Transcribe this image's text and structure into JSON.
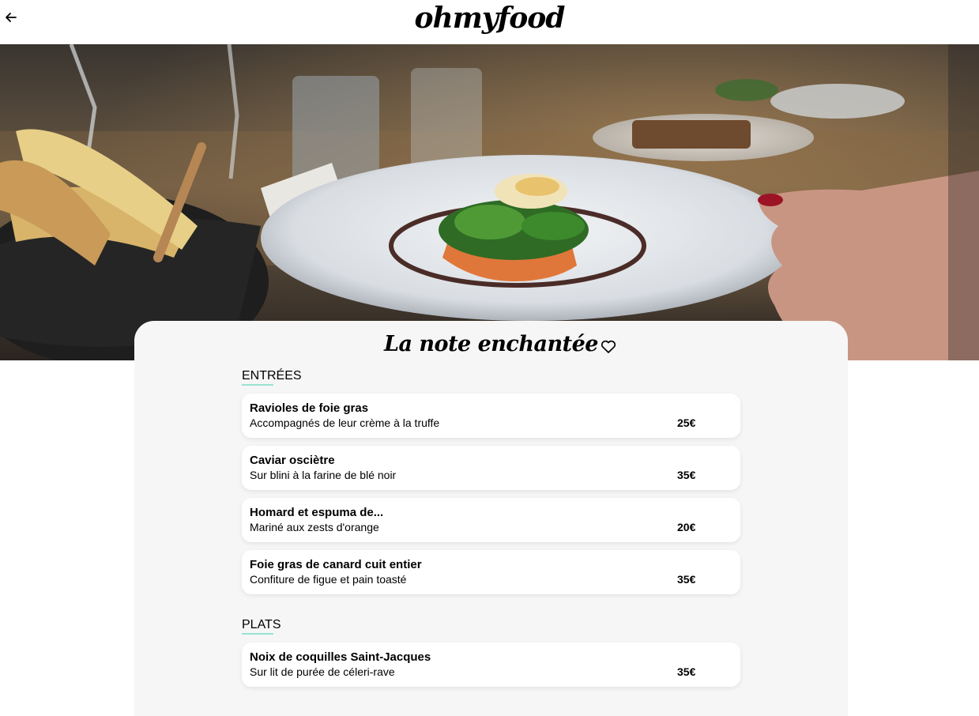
{
  "header": {
    "brand": "ohmyfood"
  },
  "restaurant": {
    "name": "La note enchantée"
  },
  "sections": [
    {
      "label": "ENTRÉES",
      "items": [
        {
          "name": "Ravioles de foie gras",
          "description": "Accompagnés de leur crème à la truffe",
          "price": "25€"
        },
        {
          "name": "Caviar osciètre",
          "description": "Sur blini à la farine de blé noir",
          "price": "35€"
        },
        {
          "name": "Homard et espuma de...",
          "description": "Mariné aux zests d'orange",
          "price": "20€"
        },
        {
          "name": "Foie gras de canard cuit entier",
          "description": "Confiture de figue et pain toasté",
          "price": "35€"
        }
      ]
    },
    {
      "label": "PLATS",
      "items": [
        {
          "name": "Noix de coquilles Saint-Jacques",
          "description": "Sur lit de purée de céleri-rave",
          "price": "35€"
        }
      ]
    }
  ],
  "colors": {
    "accent_underline": "#99e2d0",
    "sheet_background": "#f6f6f6",
    "card_background": "#ffffff"
  },
  "icons": {
    "back": "arrow-left-icon",
    "favorite": "heart-outline-icon"
  }
}
